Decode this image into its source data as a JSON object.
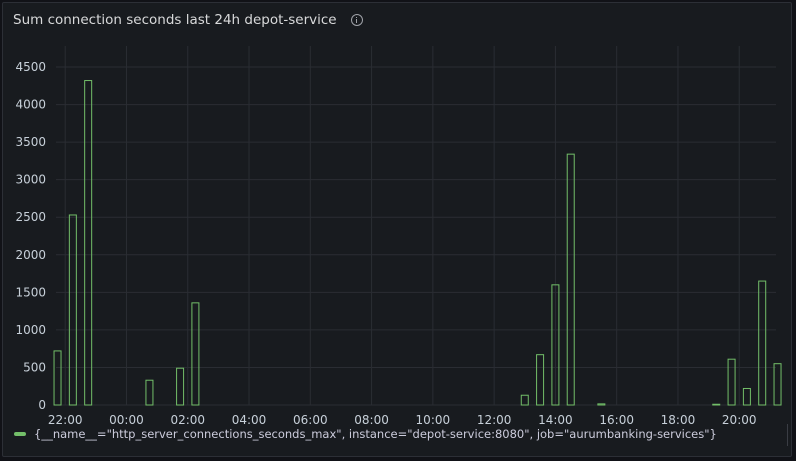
{
  "panel": {
    "title": "Sum connection seconds last 24h depot-service"
  },
  "colors": {
    "series": "#73bf69",
    "grid": "#2a2d33",
    "axis_text": "#c7d0d9",
    "background": "#181b1f"
  },
  "chart_data": {
    "type": "bar",
    "x_axis": "time",
    "y_ticks": [
      0,
      500,
      1000,
      1500,
      2000,
      2500,
      3000,
      3500,
      4000,
      4500
    ],
    "ylim": [
      0,
      4700
    ],
    "x_ticks": [
      "22:00",
      "00:00",
      "02:00",
      "04:00",
      "06:00",
      "08:00",
      "10:00",
      "12:00",
      "14:00",
      "16:00",
      "18:00",
      "20:00"
    ],
    "x_tick_hours": [
      22,
      24,
      26,
      28,
      30,
      32,
      34,
      36,
      38,
      40,
      42,
      44
    ],
    "xlim_hours": [
      21.7,
      45.2
    ],
    "grid": true,
    "legend_position": "bottom-left",
    "series": [
      {
        "name": "{__name__=\"http_server_connections_seconds_max\", instance=\"depot-service:8080\", job=\"aurumbanking-services\"}",
        "bars": [
          {
            "t": 21.75,
            "v": 720
          },
          {
            "t": 22.25,
            "v": 2530
          },
          {
            "t": 22.75,
            "v": 4320
          },
          {
            "t": 24.75,
            "v": 330
          },
          {
            "t": 25.75,
            "v": 490
          },
          {
            "t": 26.25,
            "v": 1360
          },
          {
            "t": 37.0,
            "v": 130
          },
          {
            "t": 37.5,
            "v": 670
          },
          {
            "t": 38.0,
            "v": 1600
          },
          {
            "t": 38.5,
            "v": 3340
          },
          {
            "t": 39.5,
            "v": 15
          },
          {
            "t": 43.25,
            "v": 10
          },
          {
            "t": 43.75,
            "v": 610
          },
          {
            "t": 44.25,
            "v": 220
          },
          {
            "t": 44.75,
            "v": 1650
          },
          {
            "t": 45.25,
            "v": 550
          }
        ]
      }
    ]
  }
}
